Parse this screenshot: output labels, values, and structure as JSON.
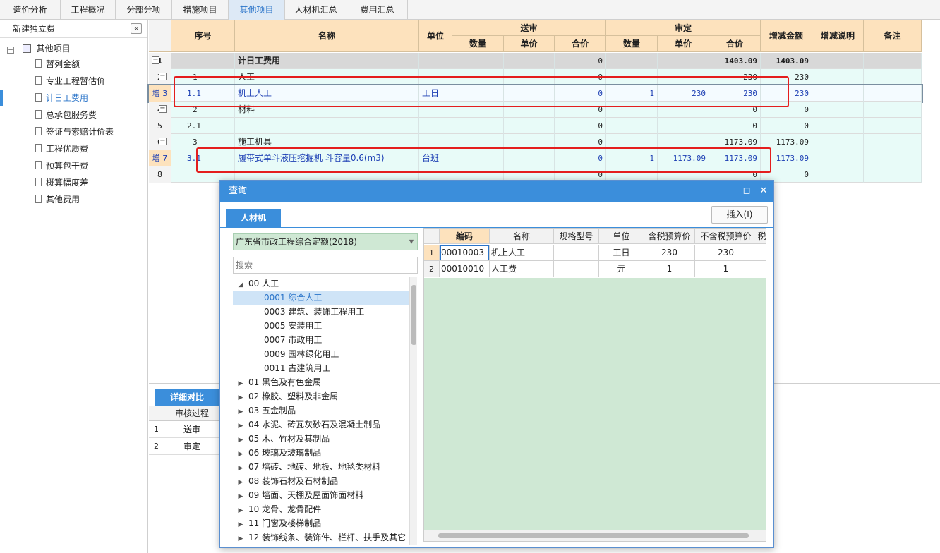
{
  "top_tabs": [
    "造价分析",
    "工程概况",
    "分部分项",
    "措施项目",
    "其他项目",
    "人材机汇总",
    "费用汇总"
  ],
  "left_panel": {
    "title": "新建独立费",
    "collapse_glyph": "«",
    "root_label": "其他项目",
    "items": [
      "暂列金额",
      "专业工程暂估价",
      "计日工费用",
      "总承包服务费",
      "签证与索赔计价表",
      "工程优质费",
      "预算包干费",
      "概算幅度差",
      "其他费用"
    ]
  },
  "grid": {
    "headers": {
      "seq": "序号",
      "name": "名称",
      "unit": "单位",
      "sent": "送审",
      "approved": "审定",
      "qty": "数量",
      "price": "单价",
      "total": "合价",
      "delta": "增减金额",
      "delta_note": "增减说明",
      "remark": "备注"
    },
    "rows": [
      {
        "rn": "1",
        "seq": "",
        "name": "计日工费用",
        "unit": "",
        "s_total": "0",
        "a_qty": "",
        "a_price": "",
        "a_total": "1403.09",
        "delta": "1403.09"
      },
      {
        "rn": "2",
        "seq": "1",
        "name": "人工",
        "unit": "",
        "s_total": "0",
        "a_qty": "",
        "a_price": "",
        "a_total": "230",
        "delta": "230"
      },
      {
        "rn": "增 3",
        "seq": "1.1",
        "name": "机上人工",
        "unit": "工日",
        "s_total": "0",
        "a_qty": "1",
        "a_price": "230",
        "a_total": "230",
        "delta": "230"
      },
      {
        "rn": "4",
        "seq": "2",
        "name": "材料",
        "unit": "",
        "s_total": "0",
        "a_qty": "",
        "a_price": "",
        "a_total": "0",
        "delta": "0"
      },
      {
        "rn": "5",
        "seq": "2.1",
        "name": "",
        "unit": "",
        "s_total": "0",
        "a_qty": "",
        "a_price": "",
        "a_total": "0",
        "delta": "0"
      },
      {
        "rn": "6",
        "seq": "3",
        "name": "施工机具",
        "unit": "",
        "s_total": "0",
        "a_qty": "",
        "a_price": "",
        "a_total": "1173.09",
        "delta": "1173.09"
      },
      {
        "rn": "增 7",
        "seq": "3.1",
        "name": "履带式单斗液压挖掘机 斗容量0.6(m3)",
        "unit": "台班",
        "s_total": "0",
        "a_qty": "1",
        "a_price": "1173.09",
        "a_total": "1173.09",
        "delta": "1173.09"
      },
      {
        "rn": "8",
        "seq": "",
        "name": "",
        "unit": "",
        "s_total": "0",
        "a_qty": "",
        "a_price": "",
        "a_total": "0",
        "delta": "0"
      }
    ]
  },
  "lower": {
    "tab": "详细对比",
    "col_header": "审核过程",
    "rows": [
      {
        "rn": "1",
        "label": "送审"
      },
      {
        "rn": "2",
        "label": "审定"
      }
    ]
  },
  "dialog": {
    "title": "查询",
    "tab": "人材机",
    "insert_label": "插入(I)",
    "library": "广东省市政工程综合定额(2018)",
    "search_placeholder": "搜索",
    "tree": [
      {
        "label": "00 人工",
        "expanded": true,
        "level": 0
      },
      {
        "label": "0001 综合人工",
        "level": 1,
        "selected": true
      },
      {
        "label": "0003 建筑、装饰工程用工",
        "level": 1
      },
      {
        "label": "0005 安装用工",
        "level": 1
      },
      {
        "label": "0007 市政用工",
        "level": 1
      },
      {
        "label": "0009 园林绿化用工",
        "level": 1
      },
      {
        "label": "0011 古建筑用工",
        "level": 1
      },
      {
        "label": "01 黑色及有色金属",
        "level": 0
      },
      {
        "label": "02 橡胶、塑料及非金属",
        "level": 0
      },
      {
        "label": "03 五金制品",
        "level": 0
      },
      {
        "label": "04 水泥、砖瓦灰砂石及混凝土制品",
        "level": 0
      },
      {
        "label": "05 木、竹材及其制品",
        "level": 0
      },
      {
        "label": "06 玻璃及玻璃制品",
        "level": 0
      },
      {
        "label": "07 墙砖、地砖、地板、地毯类材料",
        "level": 0
      },
      {
        "label": "08 装饰石材及石材制品",
        "level": 0
      },
      {
        "label": "09 墙面、天棚及屋面饰面材料",
        "level": 0
      },
      {
        "label": "10 龙骨、龙骨配件",
        "level": 0
      },
      {
        "label": "11 门窗及楼梯制品",
        "level": 0
      },
      {
        "label": "12 装饰线条、装饰件、栏杆、扶手及其它",
        "level": 0
      }
    ],
    "result_headers": [
      "编码",
      "名称",
      "规格型号",
      "单位",
      "含税预算价",
      "不含税预算价",
      "税"
    ],
    "results": [
      {
        "rn": "1",
        "code": "00010003",
        "name": "机上人工",
        "spec": "",
        "unit": "工日",
        "tax_price": "230",
        "notax_price": "230"
      },
      {
        "rn": "2",
        "code": "00010010",
        "name": "人工费",
        "spec": "",
        "unit": "元",
        "tax_price": "1",
        "notax_price": "1"
      }
    ]
  },
  "colors": {
    "accent": "#3b8edb",
    "header_bg": "#fde2bd",
    "row_bg": "#e8fbf8",
    "highlight": "#e41e1e",
    "result_bg": "#cfe8d4"
  }
}
